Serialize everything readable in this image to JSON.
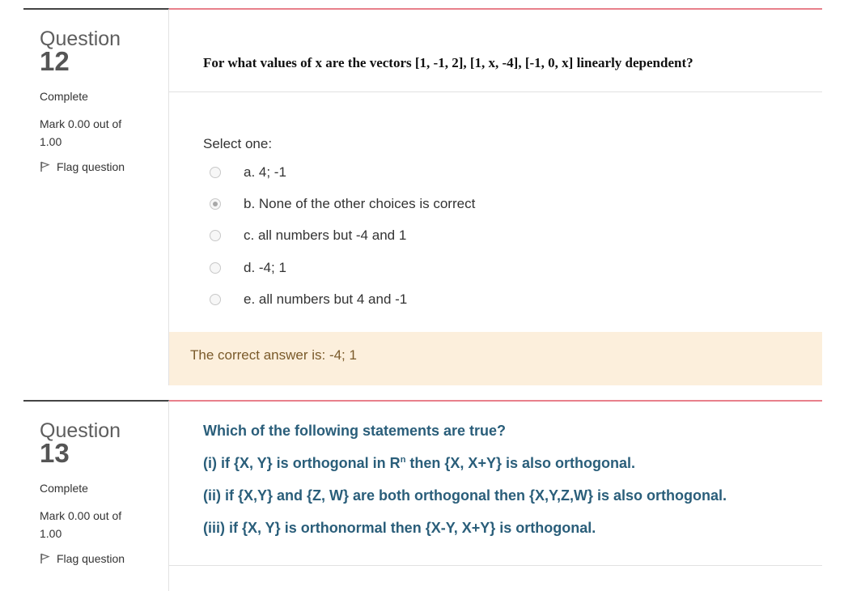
{
  "q12": {
    "label": "Question",
    "number": "12",
    "state": "Complete",
    "grade": "Mark 0.00 out of 1.00",
    "flag_label": "Flag question",
    "text": "For what values of x are the vectors [1, -1, 2], [1, x, -4], [-1, 0, x] linearly dependent?",
    "prompt": "Select one:",
    "options": [
      {
        "label": "a. 4; -1",
        "selected": false
      },
      {
        "label": "b. None of the other choices is correct",
        "selected": true
      },
      {
        "label": "c. all numbers but -4 and 1",
        "selected": false
      },
      {
        "label": "d. -4; 1",
        "selected": false
      },
      {
        "label": "e. all numbers but 4 and -1",
        "selected": false
      }
    ],
    "feedback": "The correct answer is: -4; 1"
  },
  "q13": {
    "label": "Question",
    "number": "13",
    "state": "Complete",
    "grade": "Mark 0.00 out of 1.00",
    "flag_label": "Flag question",
    "lines": [
      "Which of the following statements are true?",
      "(i) if {X, Y} is orthogonal in R",
      "n",
      " then {X, X+Y} is also orthogonal.",
      "(ii) if {X,Y} and {Z, W} are both orthogonal then {X,Y,Z,W} is also orthogonal.",
      "(iii) if {X, Y} is orthonormal then {X-Y, X+Y} is orthogonal."
    ]
  },
  "colors": {
    "question_border": "#e8808b",
    "feedback_bg": "#fcefdc",
    "q13_text": "#2a5e7a"
  },
  "icons": {
    "flag": "flag-icon",
    "radio": "radio-button"
  }
}
